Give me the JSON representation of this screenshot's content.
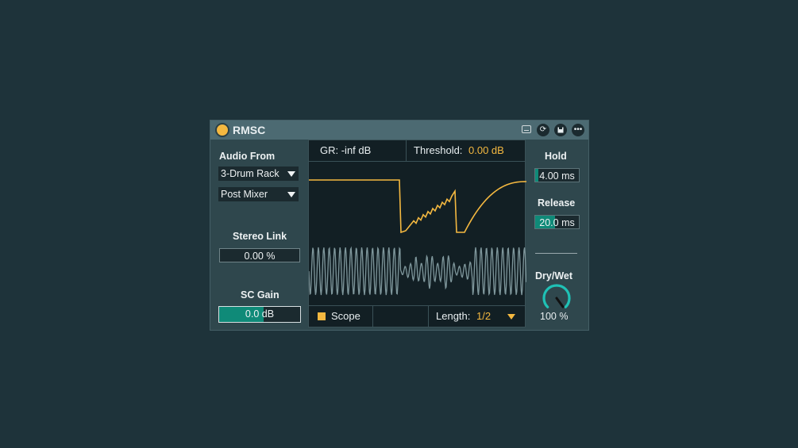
{
  "device": {
    "title": "RMSC",
    "colors": {
      "accent": "#f4b840",
      "fill": "#0f8a78",
      "knob": "#1fc1b5",
      "background": "#1e333a"
    },
    "titlebar_icons": [
      "map-icon",
      "refresh-icon",
      "save-icon",
      "more-icon"
    ]
  },
  "left": {
    "audio_from_label": "Audio From",
    "source": "3-Drum Rack",
    "tap": "Post Mixer",
    "stereo_link_label": "Stereo Link",
    "stereo_link_value": "0.00 %",
    "sc_gain_label": "SC Gain",
    "sc_gain_value": "0.0 dB",
    "sc_gain_fill": 0.55
  },
  "display": {
    "gr_text": "GR: -inf dB",
    "threshold_label": "Threshold:",
    "threshold_value": "0.00 dB",
    "scope_label": "Scope",
    "length_label": "Length:",
    "length_value": "1/2"
  },
  "right": {
    "hold_label": "Hold",
    "hold_value": "4.00 ms",
    "hold_fill": 0.08,
    "release_label": "Release",
    "release_value": "20.0 ms",
    "release_fill": 0.45,
    "drywet_label": "Dry/Wet",
    "drywet_value": "100 %",
    "drywet_fraction": 1.0
  }
}
